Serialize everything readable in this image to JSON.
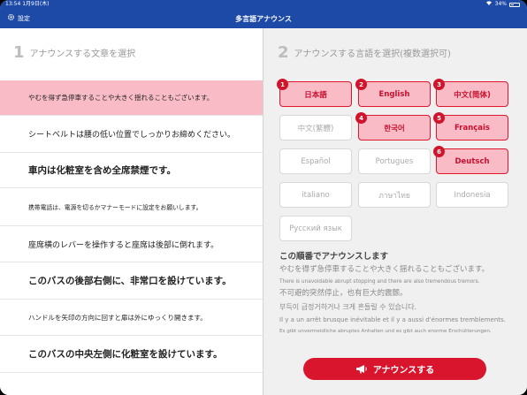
{
  "status_bar": {
    "time_date": "13:54 1月9日(木)",
    "battery": "34%"
  },
  "nav": {
    "settings_label": "設定",
    "title": "多言語アナウンス"
  },
  "step1": {
    "number": "1",
    "title": "アナウンスする文章を選択"
  },
  "step2": {
    "number": "2",
    "title": "アナウンスする言語を選択(複数選択可)"
  },
  "sentences": [
    {
      "text": "やむを得ず急停車することや大きく揺れることもございます。"
    },
    {
      "text": "シートベルトは腰の低い位置でしっかりお締めください。"
    },
    {
      "text": "車内は化粧室を含め全席禁煙です。"
    },
    {
      "text": "携帯電話は、電源を切るかマナーモードに設定をお願いします。"
    },
    {
      "text": "座席横のレバーを操作すると座席は後部に倒れます。"
    },
    {
      "text": "このバスの後部右側に、非常口を設けています。"
    },
    {
      "text": "ハンドルを矢印の方向に回すと扉は外にゆっくり開きます。"
    },
    {
      "text": "このバスの中央左側に化粧室を設けています。"
    }
  ],
  "languages": [
    {
      "label": "日本語",
      "badge": "1"
    },
    {
      "label": "English",
      "badge": "2"
    },
    {
      "label": "中文(简体)",
      "badge": "3"
    },
    {
      "label": "中文(繁體)",
      "badge": ""
    },
    {
      "label": "한국어",
      "badge": "4"
    },
    {
      "label": "Français",
      "badge": "5"
    },
    {
      "label": "Español",
      "badge": ""
    },
    {
      "label": "Portugues",
      "badge": ""
    },
    {
      "label": "Deutsch",
      "badge": "6"
    },
    {
      "label": "italiano",
      "badge": ""
    },
    {
      "label": "ภาษาไทย",
      "badge": ""
    },
    {
      "label": "Indonesia",
      "badge": ""
    },
    {
      "label": "Русский язык",
      "badge": ""
    }
  ],
  "preview": {
    "title": "この順番でアナウンスします",
    "lines": [
      "やむを得ず急停車することや大きく揺れることもございます。",
      "There is unavoidable abrupt stopping and there are also tremendous tremors.",
      "不可避的突然停止，也有巨大的震颤。",
      "부득이 급정거하거나 크게 흔들릴 수 있습니다.",
      "Il y a un arrêt brusque inévitable et il y a aussi d'énormes tremblements.",
      "Es gibt unvermeidliche abruptes Anhalten und es gibt auch enorme Erschütterungen."
    ]
  },
  "announce_button": {
    "label": "アナウンスする"
  },
  "colors": {
    "brand_blue": "#1d4aa6",
    "accent_red": "#d8152c",
    "selected_pink": "#f9bcc7"
  }
}
